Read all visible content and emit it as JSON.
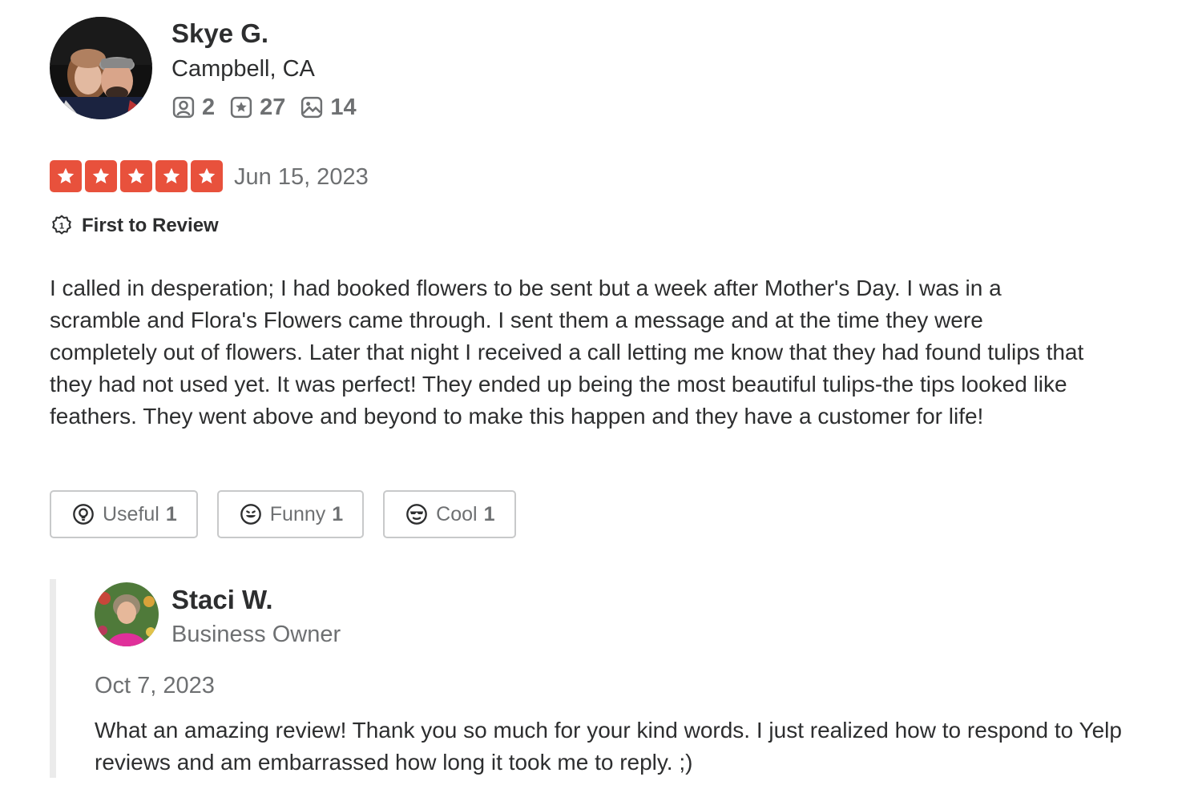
{
  "reviewer": {
    "name": "Skye G.",
    "location": "Campbell, CA",
    "avatar_icon": "user-photo-avatar",
    "stats": {
      "friends": "2",
      "reviews": "27",
      "photos": "14"
    }
  },
  "review": {
    "rating": 5,
    "rating_max": 5,
    "date": "Jun 15, 2023",
    "badge": "First to Review",
    "text": "I called in desperation; I had booked flowers to be sent but a week after Mother's Day. I was in a scramble and Flora's Flowers came through. I sent them a message and at the time they were completely out of flowers. Later that night I received a call letting me know that they had found tulips that they had not used yet. It was perfect! They ended up being the most beautiful tulips-the tips looked like feathers. They went above and beyond to make this happen and they have a customer for life!"
  },
  "reactions": [
    {
      "label": "Useful",
      "count": "1",
      "icon": "lightbulb-icon"
    },
    {
      "label": "Funny",
      "count": "1",
      "icon": "smile-icon"
    },
    {
      "label": "Cool",
      "count": "1",
      "icon": "sunglasses-icon"
    }
  ],
  "owner_reply": {
    "name": "Staci W.",
    "role": "Business Owner",
    "avatar_icon": "owner-photo-avatar",
    "date": "Oct 7, 2023",
    "text": "What an amazing review! Thank you so much for your kind words. I just realized how to respond to Yelp reviews and am embarrassed how long it took me to reply. ;)"
  },
  "colors": {
    "star_red": "#e8513c",
    "text_dark": "#2d2e2f",
    "text_gray": "#6e7072",
    "border": "#c8c9ca",
    "reply_bar": "#ebebeb"
  }
}
